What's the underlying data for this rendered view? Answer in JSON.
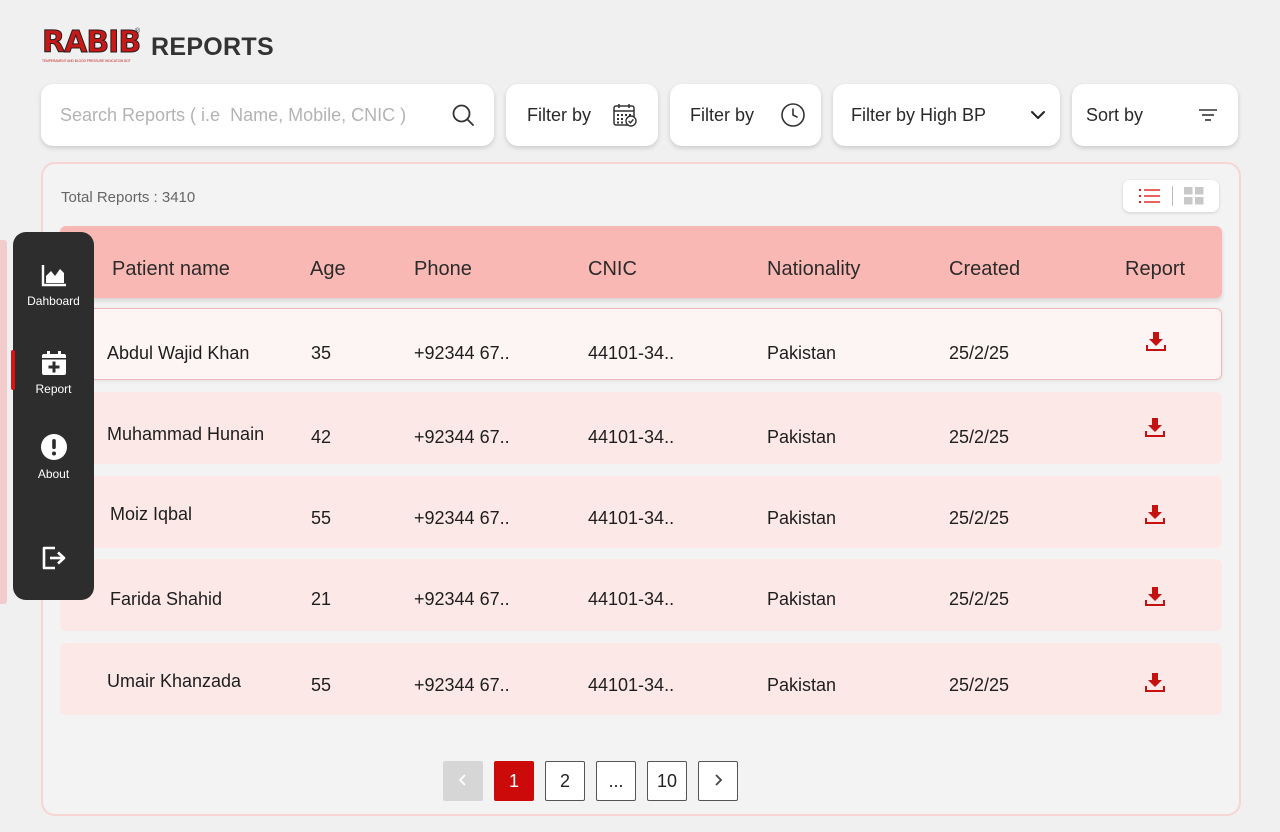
{
  "header": {
    "logo_text": "RABIB",
    "logo_tagline": "TEMPERAMENT AND BLOOD PRESSURE INDICATION BOT",
    "title": "REPORTS"
  },
  "toolbar": {
    "search_placeholder": "Search Reports ( i.e  Name, Mobile, CNIC )",
    "filter_date_label": "Filter by",
    "filter_time_label": "Filter by",
    "filter_bp_label": "Filter by High BP",
    "sort_label": "Sort by"
  },
  "summary": {
    "total_label": "Total Reports : 3410"
  },
  "table": {
    "columns": [
      "Patient name",
      "Age",
      "Phone",
      "CNIC",
      "Nationality",
      "Created",
      "Report"
    ],
    "rows": [
      {
        "name": "Abdul Wajid Khan",
        "age": "35",
        "phone": "+92344 67..",
        "cnic": "44101-34..",
        "nationality": "Pakistan",
        "created": "25/2/25"
      },
      {
        "name": "Muhammad Hunain",
        "age": "42",
        "phone": "+92344 67..",
        "cnic": "44101-34..",
        "nationality": "Pakistan",
        "created": "25/2/25"
      },
      {
        "name": "Moiz Iqbal",
        "age": "55",
        "phone": "+92344 67..",
        "cnic": "44101-34..",
        "nationality": "Pakistan",
        "created": "25/2/25"
      },
      {
        "name": "Farida Shahid",
        "age": "21",
        "phone": "+92344 67..",
        "cnic": "44101-34..",
        "nationality": "Pakistan",
        "created": "25/2/25"
      },
      {
        "name": "Umair Khanzada",
        "age": "55",
        "phone": "+92344 67..",
        "cnic": "44101-34..",
        "nationality": "Pakistan",
        "created": "25/2/25"
      }
    ],
    "download_icon": "download-icon"
  },
  "sidebar": {
    "items": [
      {
        "label": "Dahboard",
        "icon": "chart-icon"
      },
      {
        "label": "Report",
        "icon": "calendar-plus-icon"
      },
      {
        "label": "About",
        "icon": "alert-circle-icon"
      }
    ],
    "logout_icon": "logout-icon"
  },
  "pagination": {
    "pages": [
      "1",
      "2",
      "...",
      "10"
    ],
    "current": "1"
  },
  "colors": {
    "accent": "#cc0a0a",
    "header_row": "#f9b8b4",
    "row_bg": "#fde8e8",
    "sidebar_bg": "#2d2d2d"
  }
}
